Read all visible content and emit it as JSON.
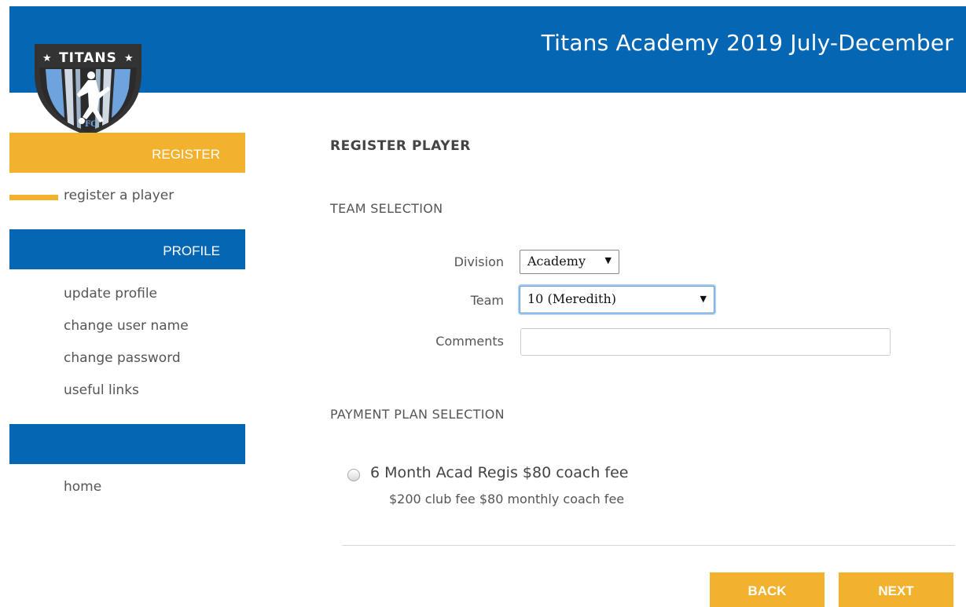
{
  "header": {
    "title": "Titans Academy 2019 July-December"
  },
  "logo": {
    "text": "TITANS",
    "sub": "FC",
    "icon": "soccer-club-crest"
  },
  "sidebar": {
    "register": {
      "label": "REGISTER",
      "items": [
        {
          "label": "register a player",
          "active": true
        }
      ]
    },
    "profile": {
      "label": "PROFILE",
      "items": [
        {
          "label": "update profile"
        },
        {
          "label": "change user name"
        },
        {
          "label": "change password"
        },
        {
          "label": "useful links"
        }
      ]
    },
    "other": {
      "label": "",
      "items": [
        {
          "label": "home"
        }
      ]
    }
  },
  "main": {
    "heading": "REGISTER PLAYER",
    "team_selection": {
      "title": "TEAM SELECTION",
      "division": {
        "label": "Division",
        "value": "Academy"
      },
      "team": {
        "label": "Team",
        "value": "10 (Meredith)"
      },
      "comments": {
        "label": "Comments",
        "value": ""
      }
    },
    "payment": {
      "title": "PAYMENT PLAN SELECTION",
      "plans": [
        {
          "name": "6 Month Acad Regis $80 coach fee",
          "description": "$200 club fee $80 monthly coach fee",
          "selected": false
        }
      ]
    },
    "buttons": {
      "back": "BACK",
      "next": "NEXT"
    }
  },
  "colors": {
    "brand_blue": "#0566b4",
    "accent_gold": "#f2b22e"
  }
}
